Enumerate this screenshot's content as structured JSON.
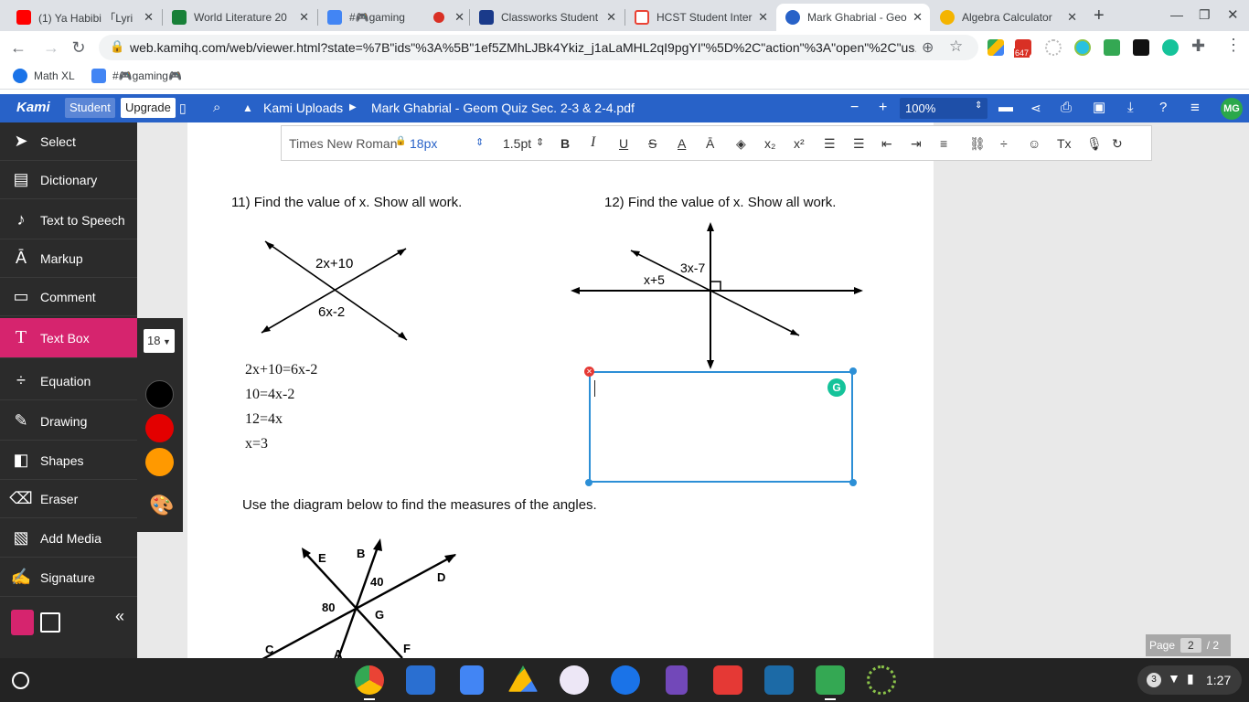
{
  "tabs": [
    {
      "title": "(1) Ya Habibi 「Lyri",
      "color": "#ff0000"
    },
    {
      "title": "World Literature 20",
      "color": "#188038"
    },
    {
      "title": "#🎮gaming",
      "color": "#4285f4"
    },
    {
      "title": "",
      "color": "#d93025"
    },
    {
      "title": "Classworks Student",
      "color": "#1a3a8a"
    },
    {
      "title": "HCST Student Inter",
      "color": "#ea4335"
    },
    {
      "title": "Mark Ghabrial - Geo",
      "color": "#2862c8"
    },
    {
      "title": "Algebra Calculator",
      "color": "#f4b400"
    }
  ],
  "url": "web.kamihq.com/web/viewer.html?state=%7B\"ids\"%3A%5B\"1ef5ZMhLJBk4Ykiz_j1aLaMHL2qI9pgYI\"%5D%2C\"action\"%3A\"open\"%2C\"us...",
  "extensions": {
    "gmail_badge": "647"
  },
  "bookmarks": [
    {
      "label": "Math XL",
      "color": "#1a73e8"
    },
    {
      "label": "#🎮gaming🎮",
      "color": "#4285f4"
    }
  ],
  "kami": {
    "logo": "Kami",
    "student_label": "Student",
    "upgrade_label": "Upgrade",
    "breadcrumb_folder": "Kami Uploads",
    "file_name": "Mark Ghabrial - Geom Quiz Sec. 2-3 & 2-4.pdf",
    "zoom": "100%",
    "avatar": "MG",
    "brand_color": "#2862c8"
  },
  "sidebar": {
    "items": [
      {
        "label": "Select",
        "icon": "cursor-icon"
      },
      {
        "label": "Dictionary",
        "icon": "book-icon"
      },
      {
        "label": "Text to Speech",
        "icon": "speaker-icon"
      },
      {
        "label": "Markup",
        "icon": "markup-icon"
      },
      {
        "label": "Comment",
        "icon": "comment-icon"
      },
      {
        "label": "Text Box",
        "icon": "text-icon"
      },
      {
        "label": "Equation",
        "icon": "equation-icon"
      },
      {
        "label": "Drawing",
        "icon": "brush-icon"
      },
      {
        "label": "Shapes",
        "icon": "shapes-icon"
      },
      {
        "label": "Eraser",
        "icon": "eraser-icon"
      },
      {
        "label": "Add Media",
        "icon": "media-icon"
      },
      {
        "label": "Signature",
        "icon": "signature-icon"
      }
    ],
    "active_color": "#d6246e"
  },
  "palette": {
    "size": "18",
    "colors": [
      "#000000",
      "#e30000",
      "#ff9900"
    ]
  },
  "format_bar": {
    "font": "Times New Roman",
    "size": "18px",
    "stroke": "1.5pt"
  },
  "document": {
    "q11": "11)  Find the value of x. Show all work.",
    "q12": "12) Find the value of x. Show all work.",
    "q11_labels": [
      "2x+10",
      "6x-2"
    ],
    "q12_labels": [
      "3x-7",
      "x+5"
    ],
    "work": [
      "2x+10=6x-2",
      "10=4x-2",
      "12=4x",
      "x=3"
    ],
    "instruction": "Use the diagram below to find the measures of the angles.",
    "diagram_labels": [
      "E",
      "B",
      "D",
      "40",
      "80",
      "G",
      "C",
      "A",
      "F"
    ]
  },
  "pager": {
    "label": "Page",
    "current": "2",
    "total": "/ 2"
  },
  "clock": "1:27",
  "notifications": "3"
}
